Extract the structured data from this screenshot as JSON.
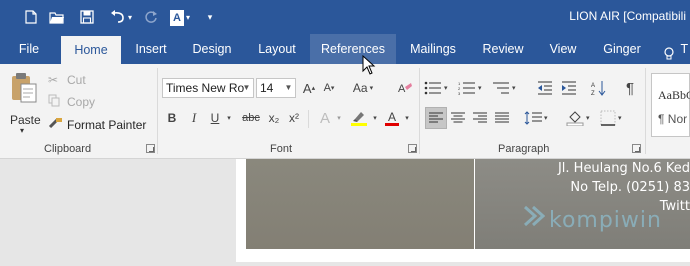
{
  "titlebar": {
    "title": "LION AIR [Compatibili",
    "qat": [
      {
        "name": "new-document-icon"
      },
      {
        "name": "open-folder-icon"
      },
      {
        "name": "save-icon"
      },
      {
        "name": "undo-icon"
      },
      {
        "name": "redo-icon"
      },
      {
        "name": "font-color-icon"
      },
      {
        "name": "customize-qat-icon"
      }
    ]
  },
  "tabs": [
    {
      "label": "File"
    },
    {
      "label": "Home"
    },
    {
      "label": "Insert"
    },
    {
      "label": "Design"
    },
    {
      "label": "Layout"
    },
    {
      "label": "References"
    },
    {
      "label": "Mailings"
    },
    {
      "label": "Review"
    },
    {
      "label": "View"
    },
    {
      "label": "Ginger"
    },
    {
      "label": "T"
    }
  ],
  "clipboard": {
    "label": "Clipboard",
    "paste": "Paste",
    "cut": "Cut",
    "copy": "Copy",
    "format_painter": "Format Painter"
  },
  "font": {
    "label": "Font",
    "font_name": "Times New Ro",
    "font_size": "14",
    "bold": "B",
    "italic": "I",
    "underline": "U",
    "strikethrough": "abc",
    "subscript": "x₂",
    "superscript": "x²",
    "change_case": "Aa",
    "text_effects": "A",
    "highlight_color": "#ffff00",
    "font_color": "#e00000"
  },
  "paragraph": {
    "label": "Paragraph"
  },
  "styles": {
    "sample": "AaBbC",
    "normal": "¶ Nor"
  },
  "document": {
    "lines": [
      "Jl. Heulang No.6 Ked",
      "No Telp. (0251) 83",
      "Twitt"
    ],
    "watermark": "kompiwin"
  },
  "colors": {
    "accent": "#2b579a",
    "ribbon_bg": "#f3f3f3"
  }
}
